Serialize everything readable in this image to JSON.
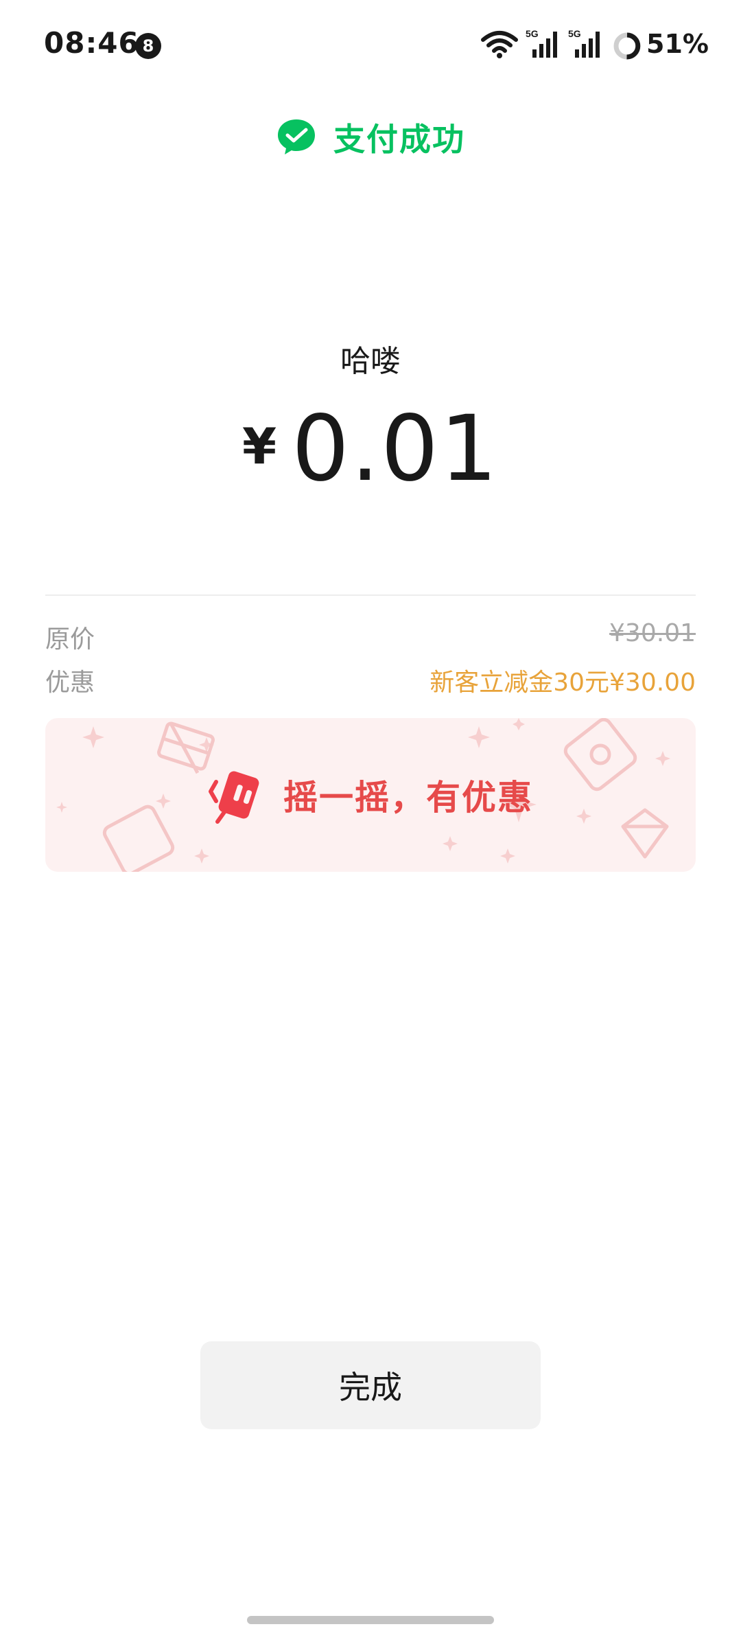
{
  "status_bar": {
    "time": "08:46",
    "notification_count": "8",
    "network_1": "5G",
    "network_2": "5G",
    "battery": "51%"
  },
  "header": {
    "title": "支付成功",
    "icon": "wechat-pay-icon",
    "color": "#07c160"
  },
  "payment": {
    "merchant": "哈喽",
    "currency_symbol": "¥",
    "amount": "0.01"
  },
  "details": [
    {
      "label": "原价",
      "value": "¥30.01"
    },
    {
      "label": "优惠",
      "value": "新客立减金30元¥30.00"
    }
  ],
  "banner": {
    "label": "摇一摇，有优惠",
    "icon": "shake-phone-icon",
    "color": "#e64a4a"
  },
  "actions": {
    "done_label": "完成"
  }
}
